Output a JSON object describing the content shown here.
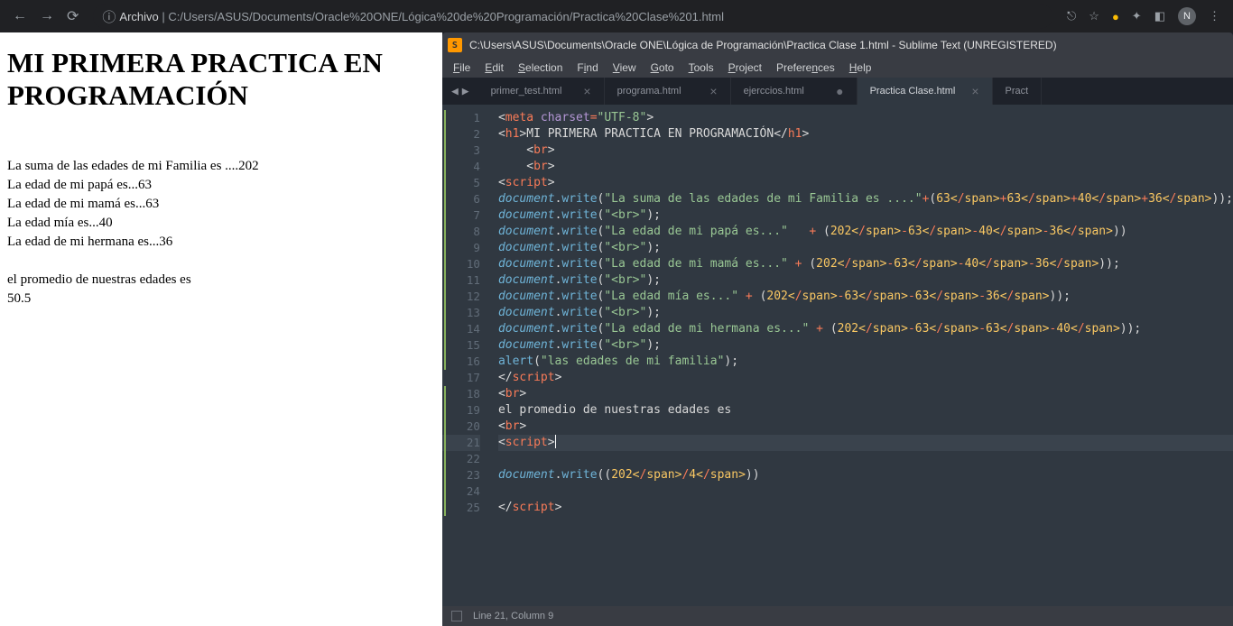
{
  "browser": {
    "url_label": "Archivo",
    "url": "C:/Users/ASUS/Documents/Oracle%20ONE/Lógica%20de%20Programación/Practica%20Clase%201.html",
    "profile_initial": "N"
  },
  "page": {
    "heading": "MI PRIMERA PRACTICA EN PROGRAMACIÓN",
    "lines": [
      "La suma de las edades de mi Familia es ....202",
      "La edad de mi papá es...63",
      "La edad de mi mamá es...63",
      "La edad mía es...40",
      "La edad de mi hermana es...36",
      "",
      "el promedio de nuestras edades es",
      "50.5"
    ]
  },
  "sublime": {
    "title": "C:\\Users\\ASUS\\Documents\\Oracle ONE\\Lógica de Programación\\Practica Clase 1.html - Sublime Text (UNREGISTERED)",
    "menu": [
      "File",
      "Edit",
      "Selection",
      "Find",
      "View",
      "Goto",
      "Tools",
      "Project",
      "Preferences",
      "Help"
    ],
    "tabs": [
      {
        "label": "primer_test.html",
        "close": "×",
        "dirty": false,
        "active": false
      },
      {
        "label": "programa.html",
        "close": "×",
        "dirty": false,
        "active": false
      },
      {
        "label": "ejerccios.html",
        "close": "●",
        "dirty": true,
        "active": false
      },
      {
        "label": "Practica Clase.html",
        "close": "×",
        "dirty": false,
        "active": true
      },
      {
        "label": "Pract",
        "close": "",
        "dirty": false,
        "active": false
      }
    ],
    "status": "Line 21, Column 9",
    "code": {
      "l1": {
        "tag": "meta",
        "attr": "charset",
        "op": "=",
        "val": "\"UTF-8\""
      },
      "l2": {
        "open": "h1",
        "text": "MI PRIMERA PRACTICA EN PROGRAMACIÓN",
        "close": "h1"
      },
      "l3": {
        "open": "br"
      },
      "l4": {
        "open": "br"
      },
      "l5": {
        "open": "script"
      },
      "l6": {
        "obj": "document",
        "m": "write",
        "s": "\"La suma de las edades de mi Familia es ....\"",
        "op": "+",
        "expr": "(63+63+40+36)"
      },
      "l7": {
        "obj": "document",
        "m": "write",
        "s": "\"<br>\""
      },
      "l8": {
        "obj": "document",
        "m": "write",
        "s": "\"La edad de mi papá es...\"",
        "sp": "   ",
        "op": "+ ",
        "expr": "(202-63-40-36)",
        "noSemi": true
      },
      "l9": {
        "obj": "document",
        "m": "write",
        "s": "\"<br>\""
      },
      "l10": {
        "obj": "document",
        "m": "write",
        "s": "\"La edad de mi mamá es...\"",
        "op": " + ",
        "expr": "(202-63-40-36)"
      },
      "l11": {
        "obj": "document",
        "m": "write",
        "s": "\"<br>\""
      },
      "l12": {
        "obj": "document",
        "m": "write",
        "s": "\"La edad mía es...\"",
        "op": " + ",
        "expr": "(202-63-63-36)"
      },
      "l13": {
        "obj": "document",
        "m": "write",
        "s": "\"<br>\""
      },
      "l14": {
        "obj": "document",
        "m": "write",
        "s": "\"La edad de mi hermana es...\"",
        "op": " + ",
        "expr": "(202-63-63-40)"
      },
      "l15": {
        "obj": "document",
        "m": "write",
        "s": "\"<br>\""
      },
      "l16": {
        "fn": "alert",
        "s": "\"las edades de mi familia\""
      },
      "l17": {
        "close": "script"
      },
      "l18": {
        "open": "br"
      },
      "l19": {
        "plain": "el promedio de nuestras edades es"
      },
      "l20": {
        "open": "br"
      },
      "l21": {
        "open": "script",
        "cursor": true
      },
      "l22": {
        "blank": true
      },
      "l23": {
        "obj": "document",
        "m": "write",
        "exprOnly": "(202/4)",
        "noSemi": true
      },
      "l24": {
        "blank": true
      },
      "l25": {
        "close": "script"
      }
    }
  }
}
